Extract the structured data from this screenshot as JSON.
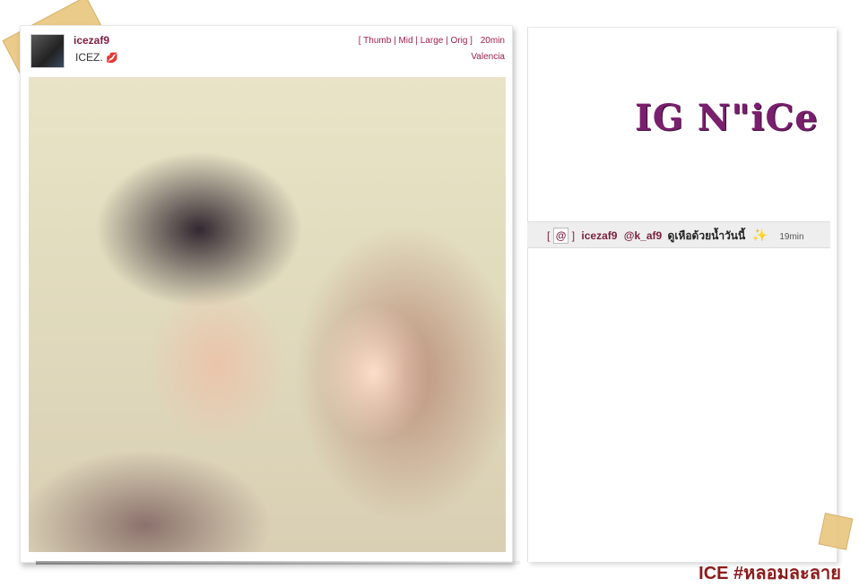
{
  "post": {
    "username": "icezaf9",
    "caption": "ICEZ.",
    "caption_emoji": "💋",
    "size_options": [
      "Thumb",
      "Mid",
      "Large",
      "Orig"
    ],
    "age": "20min",
    "location": "Valencia"
  },
  "brand": {
    "title": "IG N\"iCe"
  },
  "comment": {
    "at_icon": "@",
    "user": "icezaf9",
    "mention": "@k_af9",
    "text": "ดูเหือด้วยน้ำวันนี้",
    "emoji": "✨",
    "time": "19min"
  },
  "footer": {
    "tag": "ICE #หลอมละลาย"
  },
  "colors": {
    "accent": "#7a1f3d",
    "brand": "#7a1f6e",
    "tape": "#e8c47a"
  }
}
